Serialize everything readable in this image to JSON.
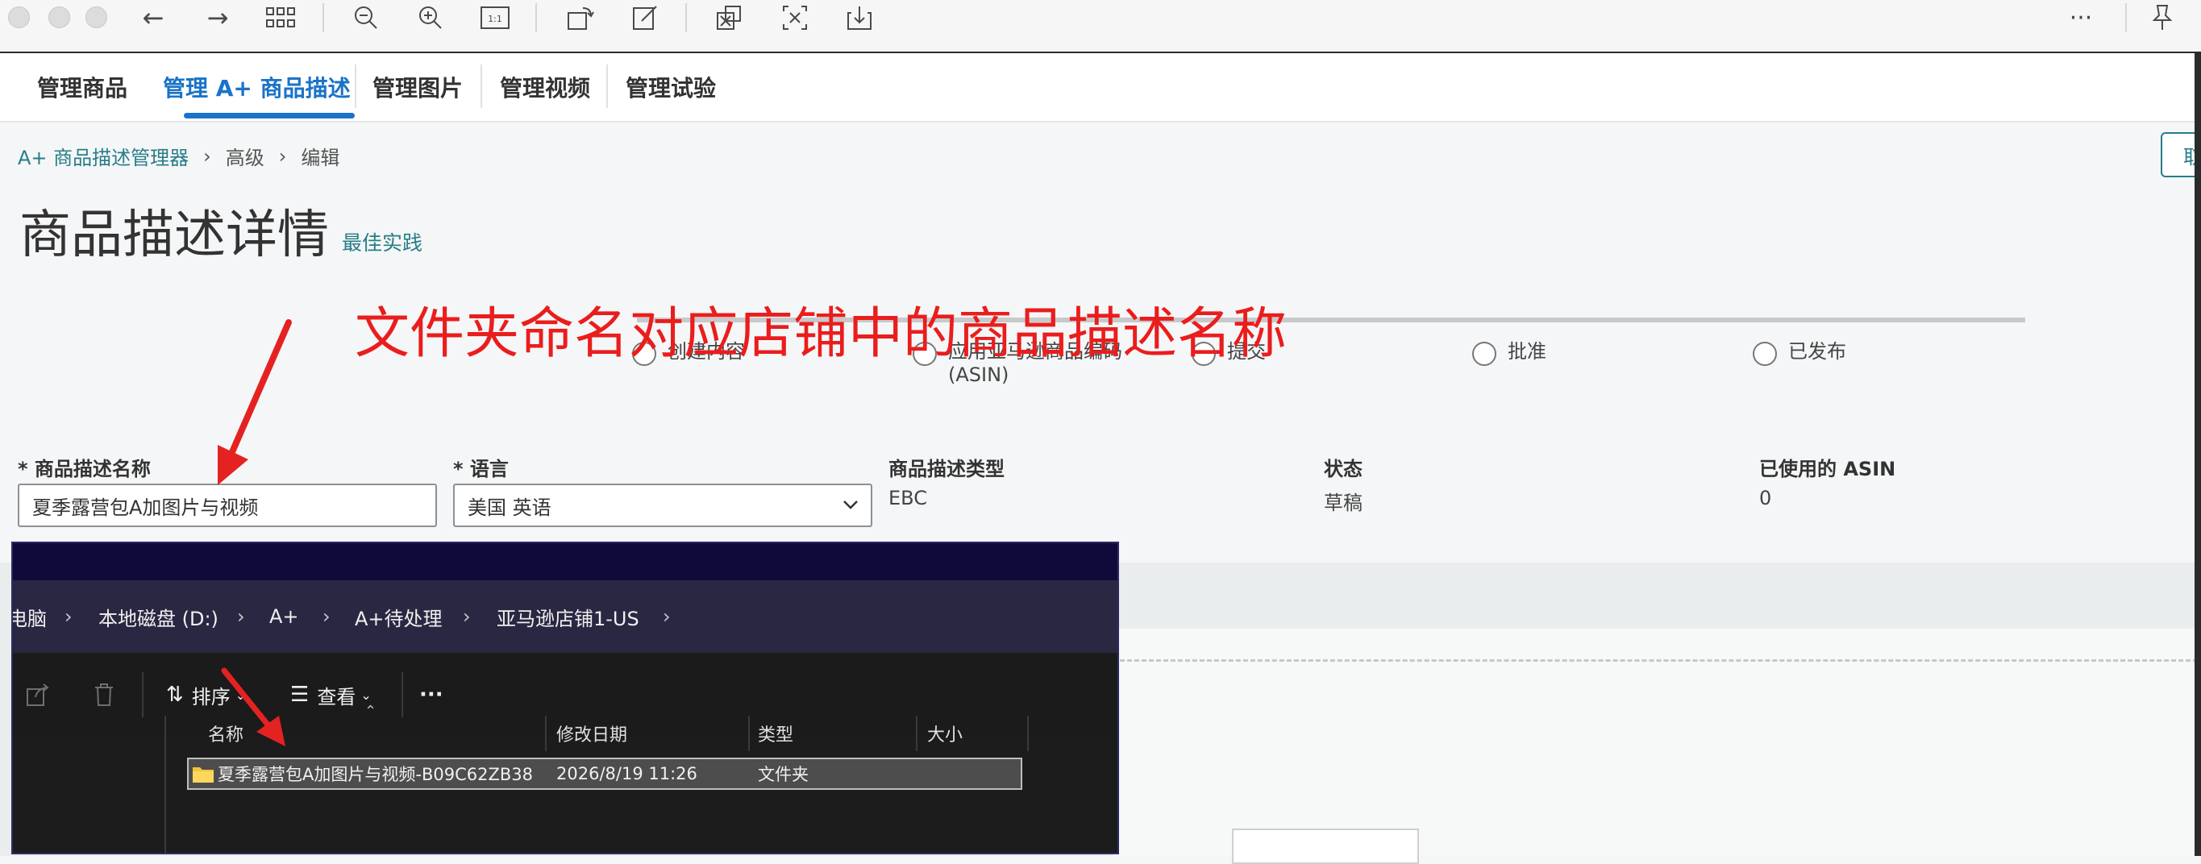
{
  "tabs": [
    "管理商品",
    "管理 A+ 商品描述",
    "管理图片",
    "管理视频",
    "管理试验"
  ],
  "breadcrumb": [
    "A+ 商品描述管理器",
    "高级",
    "编辑"
  ],
  "cancel_label": "取",
  "page_title": "商品描述详情",
  "best_practice": "最佳实践",
  "annotation": "文件夹命名对应店铺中的商品描述名称",
  "steps": [
    "创建内容",
    "应用亚马逊商品编码",
    "(ASIN)",
    "提交",
    "批准",
    "已发布"
  ],
  "fields": {
    "name_label": "* 商品描述名称",
    "name_value": "夏季露营包A加图片与视频",
    "language_label": "* 语言",
    "language_value": "美国 英语",
    "type_label": "商品描述类型",
    "type_value": "EBC",
    "status_label": "状态",
    "status_value": "草稿",
    "asin_label": "已使用的 ASIN",
    "asin_value": "0"
  },
  "explorer": {
    "path": [
      "电脑",
      "本地磁盘 (D:)",
      "A+",
      "A+待处理",
      "亚马逊店铺1-US"
    ],
    "sort_label": "排序",
    "view_label": "查看",
    "columns": [
      "名称",
      "修改日期",
      "类型",
      "大小"
    ],
    "row": {
      "name": "夏季露营包A加图片与视频-B09C62ZB38",
      "date": "2026/8/19 11:26",
      "type": "文件夹"
    }
  }
}
